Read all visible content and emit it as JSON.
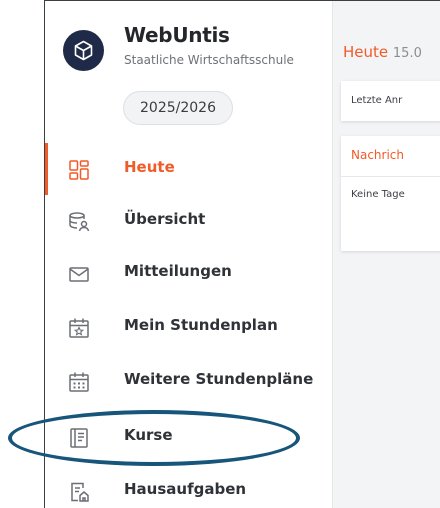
{
  "app": {
    "title": "WebUntis",
    "subtitle": "Staatliche Wirtschaftsschule",
    "school_year": "2025/2026"
  },
  "nav": {
    "items": [
      {
        "label": "Heute",
        "icon": "dashboard-icon",
        "active": true
      },
      {
        "label": "Übersicht",
        "icon": "person-stack-icon"
      },
      {
        "label": "Mitteilungen",
        "icon": "envelope-icon"
      },
      {
        "label": "Mein Stundenplan",
        "icon": "calendar-star-icon"
      },
      {
        "label": "Weitere Stundenpläne",
        "icon": "calendar-grid-icon"
      },
      {
        "label": "Kurse",
        "icon": "book-icon"
      },
      {
        "label": "Hausaufgaben",
        "icon": "homework-icon"
      }
    ]
  },
  "main": {
    "title": "Heute",
    "date": "15.0",
    "card1_text": "Letzte Anr",
    "card2_header": "Nachrich",
    "card2_text": "Keine Tage"
  },
  "colors": {
    "accent": "#f15a29",
    "logo_bg": "#1e2a47",
    "highlight_ring": "#17557a"
  }
}
